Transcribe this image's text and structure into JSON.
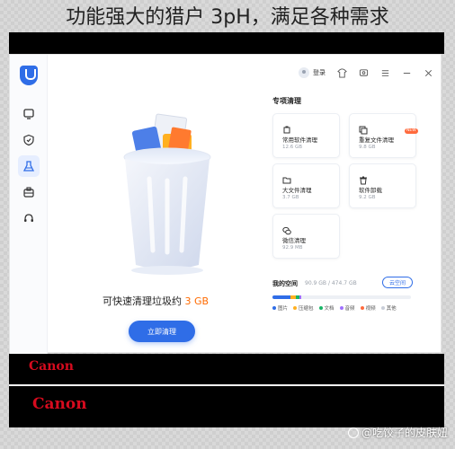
{
  "caption": "功能强大的猎户 3pH，满足各种需求",
  "topbar": {
    "login": "登录"
  },
  "hero": {
    "text_before": "可快速清理垃圾约 ",
    "amount": "3 GB",
    "clean_button": "立即清理"
  },
  "panel": {
    "title": "专项清理",
    "cards": [
      {
        "name": "常用软件清理",
        "size": "12.6 GB",
        "icon": "app-icon"
      },
      {
        "name": "重复文件清理",
        "size": "9.8 GB",
        "icon": "duplicate-icon",
        "badge": "NEW"
      },
      {
        "name": "大文件清理",
        "size": "3.7 GB",
        "icon": "folder-icon"
      },
      {
        "name": "软件卸载",
        "size": "9.2 GB",
        "icon": "trash-icon"
      },
      {
        "name": "微信清理",
        "size": "92.9 MB",
        "icon": "wechat-icon"
      }
    ]
  },
  "storage": {
    "label": "我的空间",
    "used": "90.9 GB / 474.7 GB",
    "button": "云空间",
    "legend": [
      {
        "label": "图片",
        "color": "#2f6de7"
      },
      {
        "label": "压缩包",
        "color": "#ffb020"
      },
      {
        "label": "文档",
        "color": "#18b566"
      },
      {
        "label": "音频",
        "color": "#a070ff"
      },
      {
        "label": "视频",
        "color": "#ff6a3d"
      },
      {
        "label": "其他",
        "color": "#c9ced8"
      }
    ]
  },
  "bands": {
    "brand1": "Canon",
    "brand2": "Canon"
  },
  "watermark": "@吃饺子的皮肤妞"
}
